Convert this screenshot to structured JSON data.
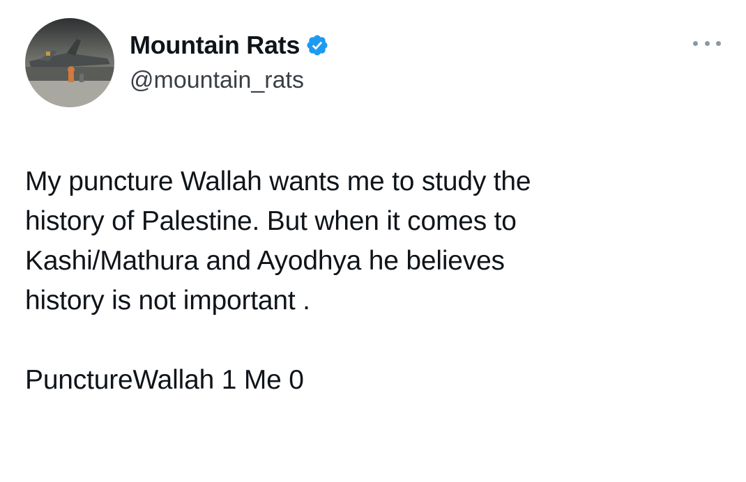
{
  "tweet": {
    "author": {
      "display_name": "Mountain Rats",
      "handle": "@mountain_rats",
      "verified": true,
      "verified_color": "#1d9bf0"
    },
    "more_icon": "more-horizontal-icon",
    "text_lines": [
      "My puncture Wallah wants me to study the",
      "history of Palestine. But when it comes to",
      "Kashi/Mathura and Ayodhya he believes",
      "history is not important ."
    ],
    "closing_line": "PunctureWallah 1 Me 0"
  }
}
